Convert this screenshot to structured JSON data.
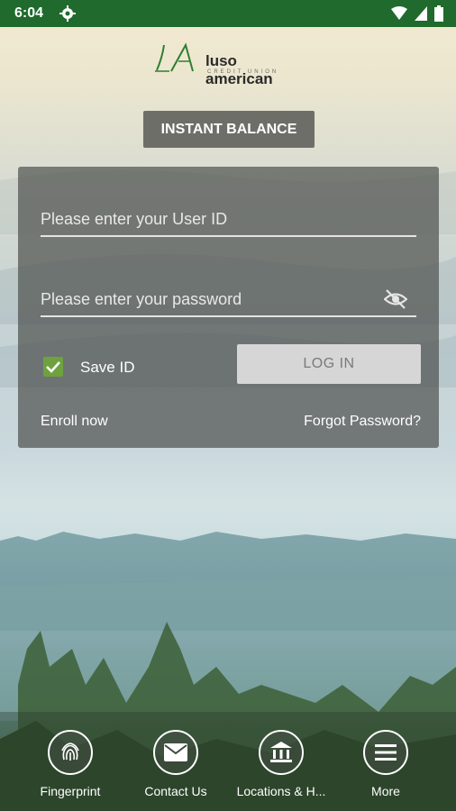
{
  "status_bar": {
    "time": "6:04",
    "icons": [
      "gear-icon",
      "wifi-icon",
      "cell-signal-icon",
      "battery-icon"
    ]
  },
  "logo": {
    "text": "luso american",
    "subtext": "CREDIT UNION"
  },
  "instant_balance": {
    "label": "INSTANT BALANCE"
  },
  "login": {
    "user_id_placeholder": "Please enter your User ID",
    "password_placeholder": "Please enter your password",
    "save_id_label": "Save ID",
    "save_id_checked": true,
    "login_label": "LOG IN",
    "enroll_label": "Enroll now",
    "forgot_label": "Forgot Password?"
  },
  "bottom_nav": {
    "items": [
      {
        "label": "Fingerprint",
        "icon": "fingerprint-icon"
      },
      {
        "label": "Contact Us",
        "icon": "mail-icon"
      },
      {
        "label": "Locations & H...",
        "icon": "bank-icon"
      },
      {
        "label": "More",
        "icon": "menu-icon"
      }
    ]
  },
  "colors": {
    "status_bar": "#1f6a2c",
    "checkbox": "#6fa23f",
    "panel": "#505350"
  }
}
